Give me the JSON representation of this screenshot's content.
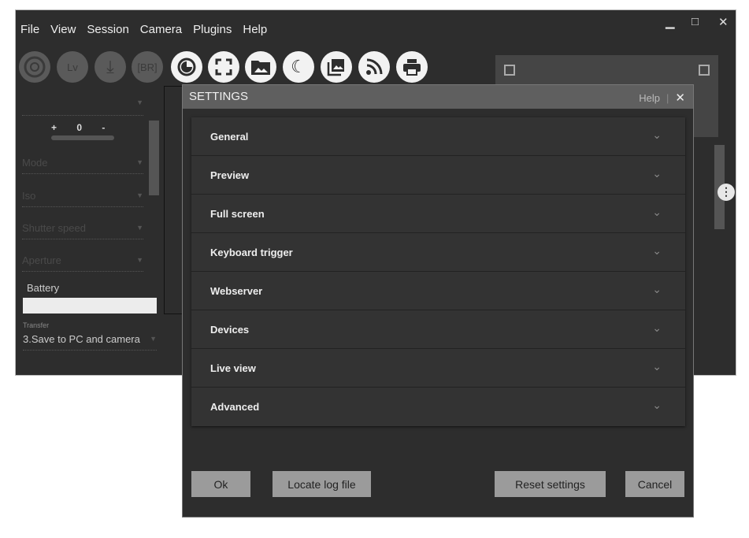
{
  "menu": [
    "File",
    "View",
    "Session",
    "Camera",
    "Plugins",
    "Help"
  ],
  "window_controls": {
    "minimize": "▁",
    "maximize": "□",
    "close": "✕"
  },
  "toolbar": {
    "lv": "Lv",
    "br": "[BR]"
  },
  "left_panel": {
    "ev_plus": "+",
    "ev_zero": "0",
    "ev_minus": "-",
    "mode": "Mode",
    "iso": "Iso",
    "shutter": "Shutter speed",
    "aperture": "Aperture",
    "battery": "Battery",
    "transfer_label": "Transfer",
    "transfer_value": "3.Save to PC and camera"
  },
  "dialog": {
    "title": "SETTINGS",
    "help": "Help",
    "close": "✕",
    "sections": [
      "General",
      "Preview",
      "Full screen",
      "Keyboard trigger",
      "Webserver",
      "Devices",
      "Live view",
      "Advanced"
    ],
    "buttons": {
      "ok": "Ok",
      "locate": "Locate log file",
      "reset": "Reset settings",
      "cancel": "Cancel"
    }
  }
}
